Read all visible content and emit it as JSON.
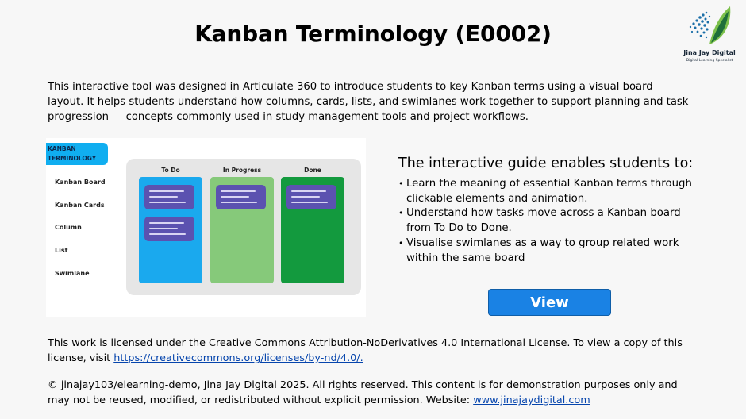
{
  "title": "Kanban Terminology (E0002)",
  "logo": {
    "name": "Jina Jay Digital",
    "tagline": "Digital Learning Specialist",
    "colors": {
      "leaf_dark": "#1f6f3a",
      "leaf_light": "#7cc04b",
      "dots": "#1b6fa8"
    }
  },
  "intro": "This interactive tool was designed in Articulate 360 to introduce students to key Kanban terms using a visual board layout. It helps students understand how columns, cards, lists, and swimlanes work together to support planning and task progression — concepts commonly used in study management tools and project workflows.",
  "thumbnail": {
    "tag": "KANBAN TERMINOLOGY",
    "nav_items": [
      "Kanban Board",
      "Kanban Cards",
      "Column",
      "List",
      "Swimlane"
    ],
    "columns": [
      {
        "name": "To Do",
        "color": "#1aa9ee",
        "cards": 2
      },
      {
        "name": "In Progress",
        "color": "#86c97a",
        "cards": 1
      },
      {
        "name": "Done",
        "color": "#139a3e",
        "cards": 1
      }
    ],
    "card_color": "#5b52b0"
  },
  "guide": {
    "heading": "The interactive guide enables students to:",
    "items": [
      "Learn the meaning of essential Kanban terms through clickable elements and animation.",
      "Understand how tasks move across a Kanban board from To Do to Done.",
      "Visualise swimlanes as a way to group related work within the same board"
    ]
  },
  "view_button": "View",
  "license": {
    "text": "This work is licensed under the Creative Commons Attribution-NoDerivatives 4.0 International License. To view a copy of this license, visit ",
    "link": "https://creativecommons.org/licenses/by-nd/4.0/."
  },
  "copyright": {
    "text": "© jinajay103/elearning-demo, Jina Jay Digital 2025. All rights reserved. This content is for demonstration purposes only and may not be reused, modified, or redistributed without explicit permission. Website: ",
    "link": "www.jinajaydigital.com"
  }
}
